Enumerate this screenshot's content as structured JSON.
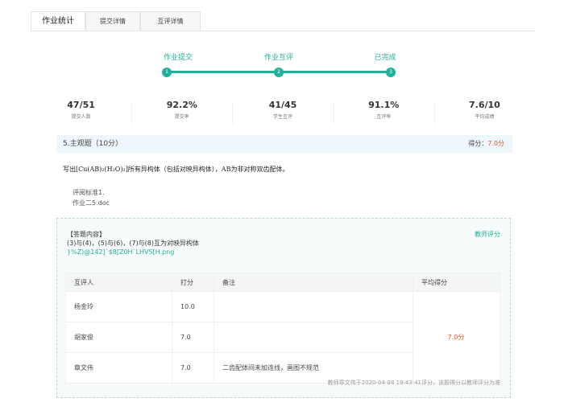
{
  "tabs": [
    {
      "label": "作业统计"
    },
    {
      "label": "提交详情"
    },
    {
      "label": "互评详情"
    }
  ],
  "steps": [
    {
      "label": "作业提交",
      "num": "1"
    },
    {
      "label": "作业互评",
      "num": "2"
    },
    {
      "label": "已完成",
      "num": "3"
    }
  ],
  "stats": [
    {
      "value": "47/51",
      "label": "提交人数"
    },
    {
      "value": "92.2%",
      "label": "提交率"
    },
    {
      "value": "41/45",
      "label": "学生互评"
    },
    {
      "value": "91.1%",
      "label": "互评率"
    },
    {
      "value": "7.6/10",
      "label": "平均成绩"
    }
  ],
  "question": {
    "title": "5.主观题（10分）",
    "score_label": "得分：",
    "score_value": "7.0分",
    "text": "写出[Cu(AB)₂(H₂O)₂]所有异构体（包括对映异构体），AB为非对称双齿配体。",
    "criteria": "评阅标准1.",
    "attachment": "作业二5.doc"
  },
  "answer": {
    "title": "【答题内容】",
    "content": "(3)与(4)，(5)与(6)，(7)与(8)互为对映异构体",
    "file": "}%Z)@142]`$8[Z0H`LHVS[H.png",
    "teacher_label": "教师评分"
  },
  "table": {
    "headers": [
      "互评人",
      "打分",
      "备注",
      "平均得分"
    ],
    "rows": [
      {
        "name": "杨金玲",
        "score": "10.0",
        "note": ""
      },
      {
        "name": "胡家俊",
        "score": "7.0",
        "note": ""
      },
      {
        "name": "章文伟",
        "score": "7.0",
        "note": "二齿配体间未加连线，画图不规范"
      }
    ],
    "average": "7.0分"
  },
  "footnote": "教师章文伟于2020-04-08 19:43:41评分，该题得分以教师评分为准"
}
